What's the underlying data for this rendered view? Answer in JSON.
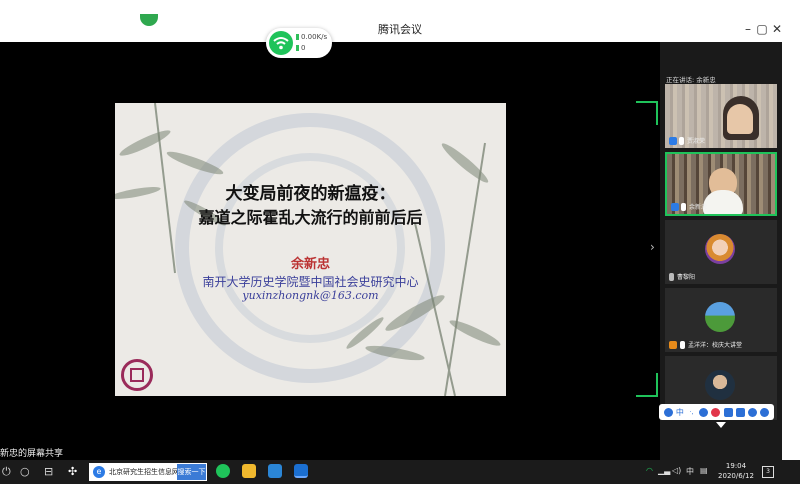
{
  "window": {
    "title": "腾讯会议",
    "minimize": "–",
    "maximize": "▢",
    "close": "✕"
  },
  "network": {
    "speed": "0.00K/s",
    "count": "0"
  },
  "slide": {
    "title_line1": "大变局前夜的新瘟疫：",
    "title_line2": "嘉道之际霍乱大流行的前前后后",
    "author": "余新忠",
    "institution": "南开大学历史学院暨中国社会史研究中心",
    "email": "yuxinzhongnk@163.com"
  },
  "sidebar": {
    "speaking_label": "正在讲话: 余新忠",
    "participants": [
      {
        "name": "贾淑荣"
      },
      {
        "name": "余新忠"
      },
      {
        "name": "曹黎阳"
      },
      {
        "name": "孟洋洋：校庆大讲堂"
      },
      {
        "name": ""
      }
    ]
  },
  "float_toolbar": {
    "items": [
      "user",
      "中",
      "·,",
      "smile",
      "keyboard",
      "screen",
      "mic",
      "shirt",
      "gear"
    ],
    "ime_label": "中"
  },
  "share": {
    "label": "新忠的屏幕共享"
  },
  "taskbar": {
    "search_text": "北京研究生招生信息网",
    "search_button": "搜索一下",
    "ime": "中",
    "time": "19:04",
    "date": "2020/6/12",
    "notifications": "3"
  },
  "colors": {
    "accent_green": "#1fc35a",
    "stage_bg": "#000000",
    "sidebar_bg": "#1a1a1a"
  }
}
